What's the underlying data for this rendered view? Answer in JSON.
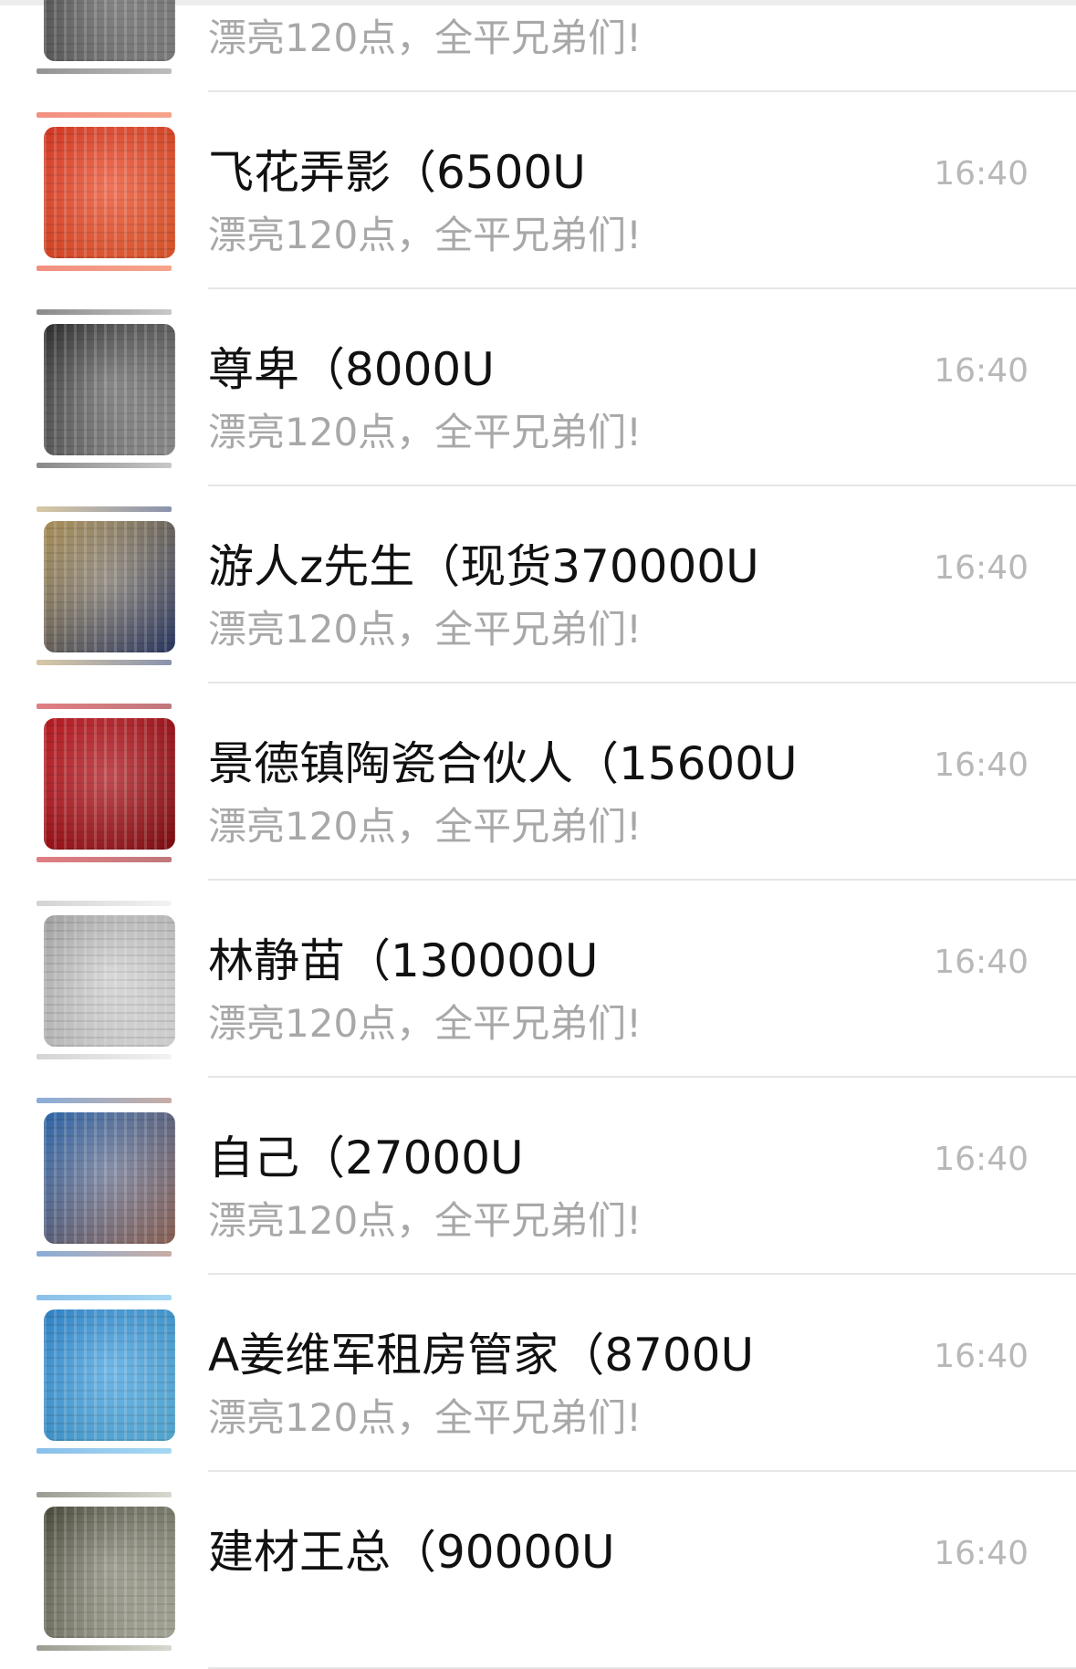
{
  "chats": [
    {
      "name": "",
      "preview": "漂亮120点，全平兄弟们!",
      "time": "",
      "avatar_color": "#3a3a3a",
      "avatar_color2": "#888888"
    },
    {
      "name": "飞花弄影（6500U",
      "preview": "漂亮120点，全平兄弟们!",
      "time": "16:40",
      "avatar_color": "#e8341c",
      "avatar_color2": "#f05a2a"
    },
    {
      "name": "尊卑（8000U",
      "preview": "漂亮120点，全平兄弟们!",
      "time": "16:40",
      "avatar_color": "#2a2a2a",
      "avatar_color2": "#9a9a9a"
    },
    {
      "name": "游人z先生（现货370000U",
      "preview": "漂亮120点，全平兄弟们!",
      "time": "16:40",
      "avatar_color": "#b89a5a",
      "avatar_color2": "#2a3a6a"
    },
    {
      "name": "景德镇陶瓷合伙人（15600U",
      "preview": "漂亮120点，全平兄弟们!",
      "time": "16:40",
      "avatar_color": "#c8141c",
      "avatar_color2": "#8a0a10"
    },
    {
      "name": "林静苗（130000U",
      "preview": "漂亮120点，全平兄弟们!",
      "time": "16:40",
      "avatar_color": "#b0b0b0",
      "avatar_color2": "#e8e8e8"
    },
    {
      "name": "自己（27000U",
      "preview": "漂亮120点，全平兄弟们!",
      "time": "16:40",
      "avatar_color": "#2a6ab8",
      "avatar_color2": "#9a6a5a"
    },
    {
      "name": "A姜维军租房管家（8700U",
      "preview": "漂亮120点，全平兄弟们!",
      "time": "16:40",
      "avatar_color": "#2a8ad8",
      "avatar_color2": "#5ab8e8"
    },
    {
      "name": "建材王总（90000U",
      "preview": "",
      "time": "16:40",
      "avatar_color": "#4a4a3a",
      "avatar_color2": "#b8b8a8"
    }
  ]
}
